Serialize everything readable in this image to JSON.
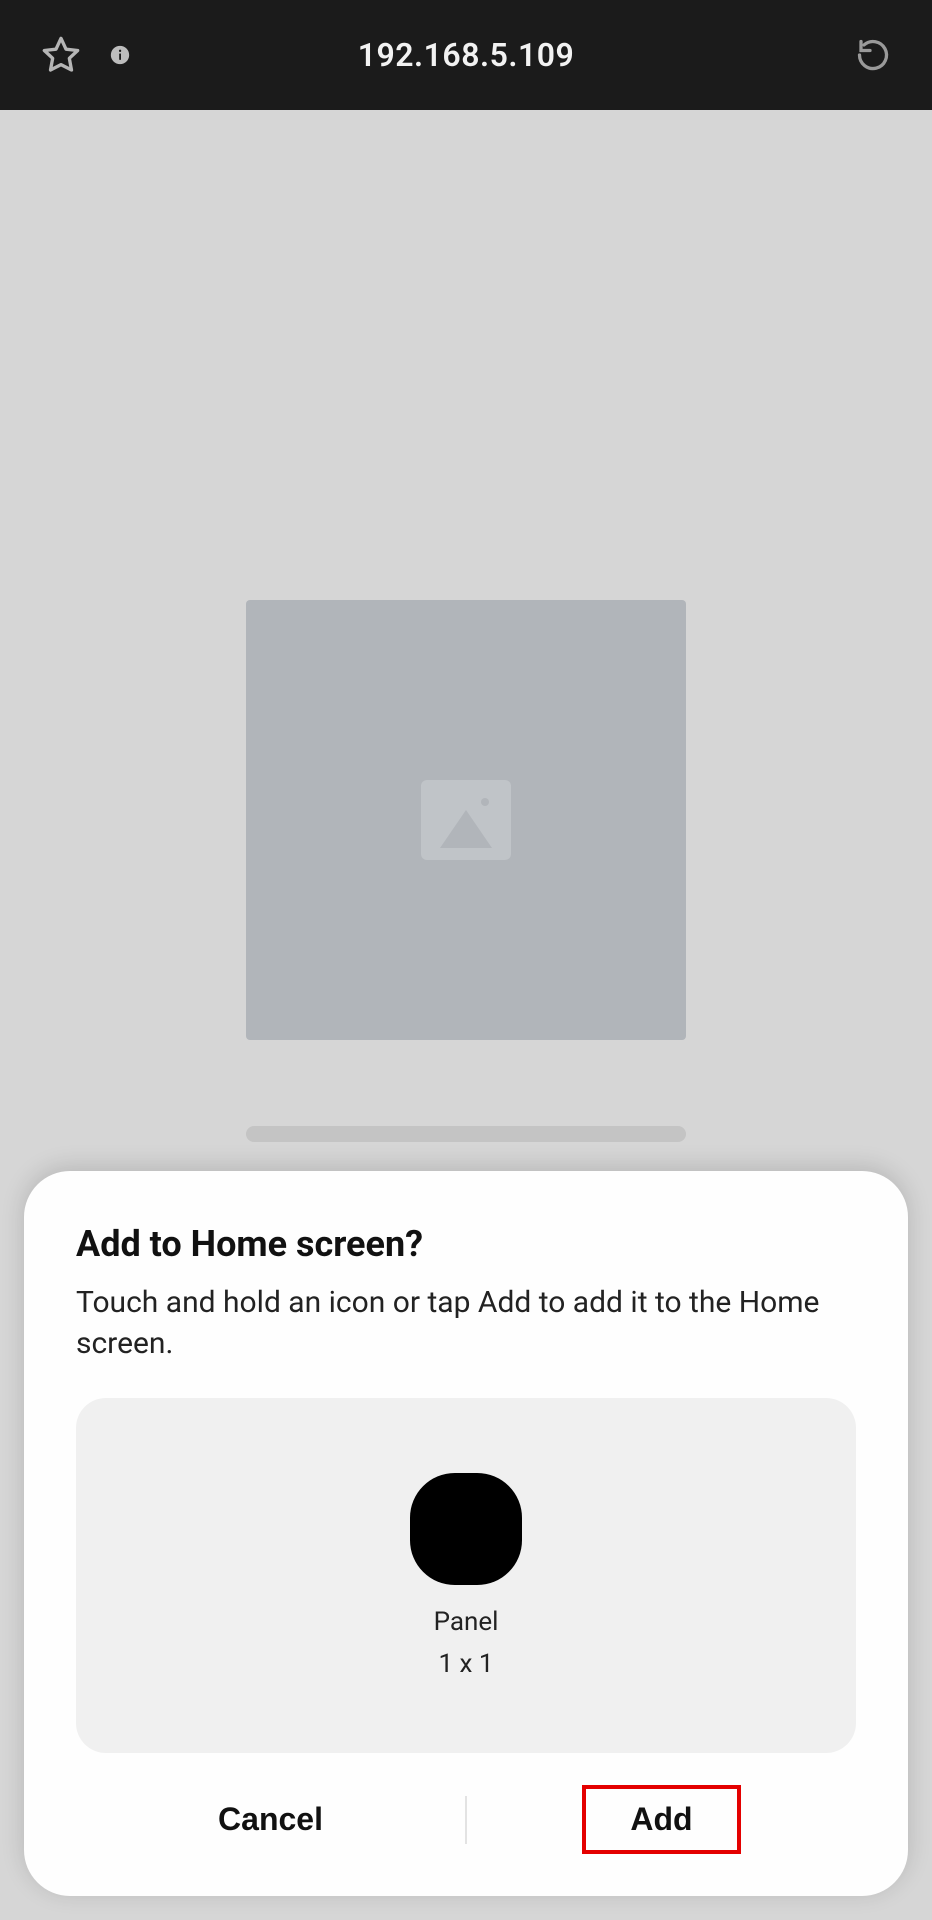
{
  "addressBar": {
    "url": "192.168.5.109"
  },
  "sheet": {
    "title": "Add to Home screen?",
    "subtitle": "Touch and hold an icon or tap Add to add it to the Home screen.",
    "widget": {
      "name": "Panel",
      "size": "1 x 1"
    },
    "actions": {
      "cancel": "Cancel",
      "add": "Add"
    }
  }
}
